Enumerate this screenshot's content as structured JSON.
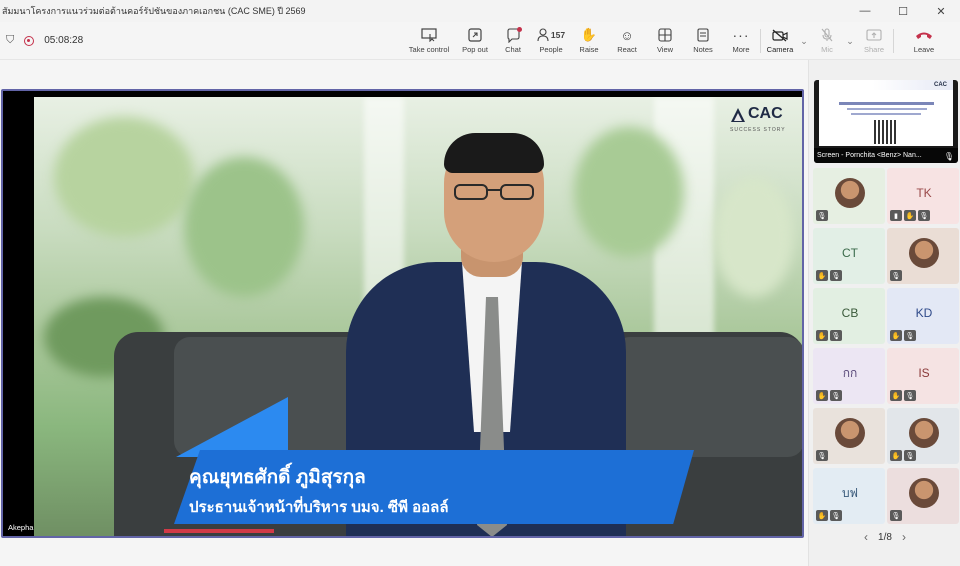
{
  "window": {
    "title": "สัมมนาโครงการแนวร่วมต่อต้านคอร์รัปชันของภาคเอกชน (CAC SME) ปี 2569",
    "controls": [
      "minimize",
      "maximize",
      "close"
    ]
  },
  "toolbar": {
    "timer": "05:08:28",
    "items": [
      {
        "label": "Take control",
        "icon": "take-control-icon"
      },
      {
        "label": "Pop out",
        "icon": "pop-out-icon"
      },
      {
        "label": "Chat",
        "icon": "chat-icon",
        "badge": ""
      },
      {
        "label": "People",
        "icon": "people-icon",
        "count": "157"
      },
      {
        "label": "Raise",
        "icon": "raise-hand-icon"
      },
      {
        "label": "React",
        "icon": "react-icon"
      },
      {
        "label": "View",
        "icon": "view-icon"
      },
      {
        "label": "Notes",
        "icon": "notes-icon"
      },
      {
        "label": "More",
        "icon": "more-icon"
      },
      {
        "label": "Camera",
        "icon": "camera-off-icon"
      },
      {
        "label": "Mic",
        "icon": "mic-off-icon",
        "disabled": true
      },
      {
        "label": "Share",
        "icon": "share-icon",
        "disabled": true
      },
      {
        "label": "Leave",
        "icon": "leave-icon"
      }
    ]
  },
  "stage": {
    "participant_label": "Akepha",
    "logo_text": "CAC",
    "logo_subtext": "SUCCESS STORY",
    "caption_name": "คุณยุทธศักดิ์ ภูมิสุรกุล",
    "caption_role": "ประธานเจ้าหน้าที่บริหาร บมจ. ซีพี ออลล์"
  },
  "side_panel": {
    "screen_share_label": "Screen - Pornchita <Benz> Nan...",
    "slide_logo": "CAC",
    "tiles": [
      {
        "initials": "",
        "photo": true,
        "bg": "#e6efe2",
        "badges": [
          "mic-off"
        ]
      },
      {
        "initials": "TK",
        "photo": false,
        "bg": "#f7e3e3",
        "color": "#9a4a4a",
        "badges": [
          "signal",
          "raise",
          "mic-off"
        ]
      },
      {
        "initials": "CT",
        "photo": false,
        "bg": "#e2efe6",
        "color": "#3a6a4a",
        "badges": [
          "raise",
          "mic-off"
        ]
      },
      {
        "initials": "",
        "photo": true,
        "bg": "#eaddd5",
        "badges": [
          "mic-off"
        ]
      },
      {
        "initials": "CB",
        "photo": false,
        "bg": "#e2efe2",
        "color": "#3a5a3a",
        "badges": [
          "raise",
          "mic-off"
        ]
      },
      {
        "initials": "KD",
        "photo": false,
        "bg": "#e3e8f5",
        "color": "#2f4a8a",
        "badges": [
          "raise",
          "mic-off"
        ]
      },
      {
        "initials": "กก",
        "photo": false,
        "bg": "#ece6f3",
        "color": "#5a4a7a",
        "badges": [
          "raise",
          "mic-off"
        ]
      },
      {
        "initials": "IS",
        "photo": false,
        "bg": "#f5e3e3",
        "color": "#8a3a3a",
        "badges": [
          "raise",
          "mic-off"
        ]
      },
      {
        "initials": "",
        "photo": true,
        "bg": "#e9e2dc",
        "badges": [
          "mic-off"
        ]
      },
      {
        "initials": "",
        "photo": true,
        "bg": "#e2e6ea",
        "badges": [
          "raise",
          "mic-off"
        ]
      },
      {
        "initials": "บฟ",
        "photo": false,
        "bg": "#e3ecf3",
        "color": "#3a5a7a",
        "badges": [
          "raise",
          "mic-off"
        ]
      },
      {
        "initials": "",
        "photo": true,
        "bg": "#ecdede",
        "badges": [
          "mic-off"
        ]
      }
    ],
    "page_indicator": "1/8"
  },
  "colors": {
    "accent": "#6264a7",
    "leave": "#c4314b",
    "caption_blue": "#1d6fd6"
  }
}
